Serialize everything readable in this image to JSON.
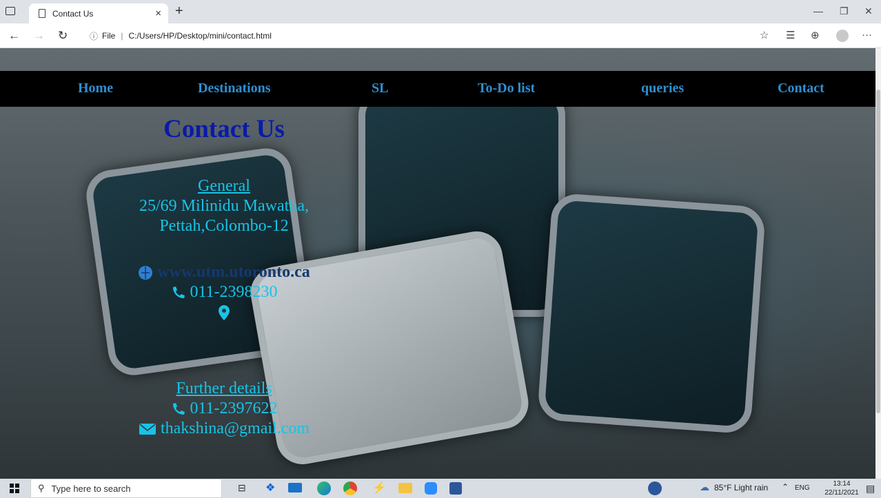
{
  "browser": {
    "tab_title": "Contact Us",
    "tab_close": "×",
    "new_tab": "+",
    "url_info": "ⓘ",
    "url_file": "File",
    "url_path": "C:/Users/HP/Desktop/mini/contact.html"
  },
  "nav": {
    "items": [
      "Home",
      "Destinations",
      "SL",
      "To-Do list",
      "queries",
      "Contact"
    ]
  },
  "contact": {
    "title": "Contact Us",
    "general_heading": "General",
    "address_line1": "25/69 Milinidu Mawatha,",
    "address_line2": "Pettah,Colombo-12",
    "website": "www.utm.utoronto.ca",
    "phone1": "011-2398230",
    "further_heading": "Further details",
    "phone2": "011-2397622",
    "email": "thakshina@gmail.com"
  },
  "taskbar": {
    "search_placeholder": "Type here to search",
    "weather": "85°F  Light rain",
    "lang": "ENG",
    "time": "13:14",
    "date": "22/11/2021"
  },
  "colors": {
    "nav_bg": "#000000",
    "nav_link": "#2f8fd0",
    "title": "#0a1aa8",
    "text": "#18c3e6"
  }
}
